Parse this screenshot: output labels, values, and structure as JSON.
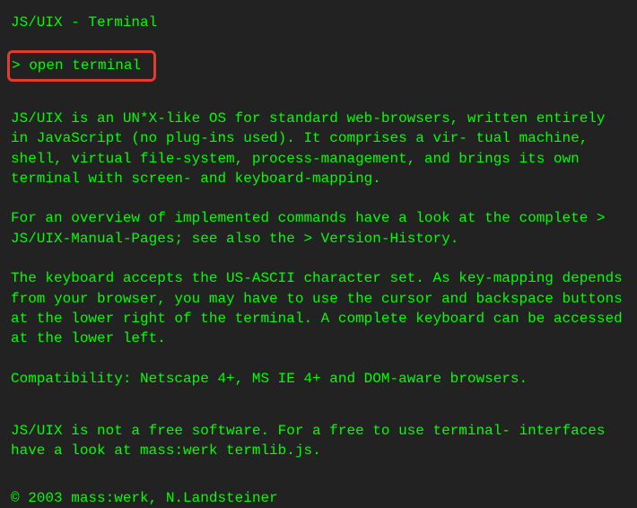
{
  "title": "JS/UIX - Terminal",
  "open_terminal": {
    "prefix": "> ",
    "label": "open terminal"
  },
  "intro": "JS/UIX is an UN*X-like OS for standard web-browsers, written entirely in JavaScript (no plug-ins used). It comprises a vir-\ntual machine, shell, virtual file-system, process-management, and brings its own terminal with screen- and keyboard-mapping.",
  "overview": {
    "pre": "For an overview of implemented commands have a look at the complete > ",
    "manual_link": "JS/UIX-Manual-Pages",
    "mid": "; see also the > ",
    "version_link": "Version-History",
    "post": "."
  },
  "keyboard": "The keyboard accepts the US-ASCII character set.\nAs key-mapping depends from your browser, you may have to use the cursor and backspace buttons at the lower right of the terminal. A complete keyboard can be accessed at the lower left.",
  "compat": "Compatibility: Netscape 4+, MS IE 4+ and DOM-aware browsers.",
  "notfree": {
    "pre": "JS/UIX is not a free software. For a free to use terminal-\ninterfaces have a look at ",
    "link": "mass:werk termlib.js",
    "post": "."
  },
  "copyright": "© 2003 mass:werk, N.Landsteiner"
}
